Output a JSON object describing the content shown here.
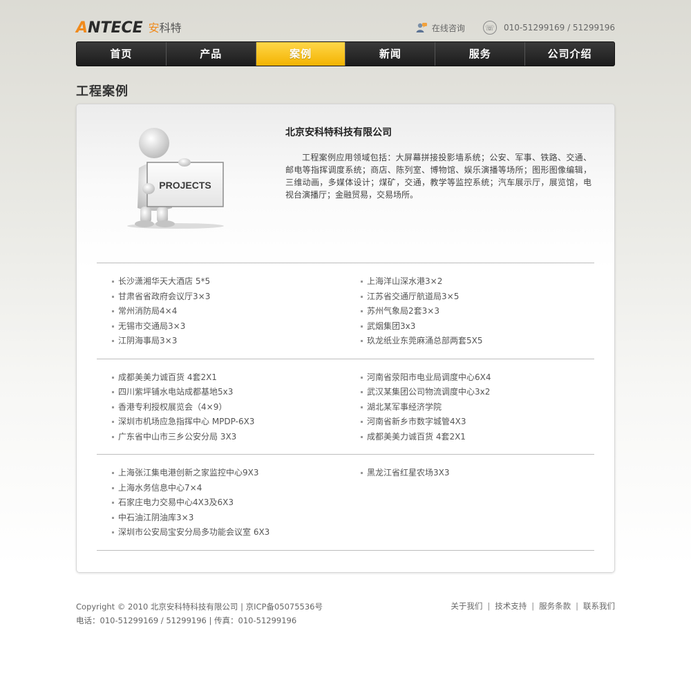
{
  "header": {
    "logo_latin_first": "A",
    "logo_latin_rest": "NTECE",
    "logo_cn_first": "安",
    "logo_cn_rest": "科特",
    "consult_label": "在线咨询",
    "phone_label": "010-51299169 / 51299196"
  },
  "nav": {
    "items": [
      {
        "label": "首页"
      },
      {
        "label": "产品"
      },
      {
        "label": "案例"
      },
      {
        "label": "新闻"
      },
      {
        "label": "服务"
      },
      {
        "label": "公司介绍"
      }
    ],
    "active_index": 2
  },
  "page_title": "工程案例",
  "main": {
    "image_label": "PROJECTS",
    "company_name": "北京安科特科技有限公司",
    "intro": "工程案例应用领域包括：大屏幕拼接投影墙系统；公安、军事、铁路、交通、邮电等指挥调度系统；商店、陈列室、博物馆、娱乐演播等场所；图形图像编辑，三维动画，多媒体设计；煤矿，交通，教学等监控系统；汽车展示厅，展览馆，电视台演播厅；金融贸易，交易场所。"
  },
  "projects": {
    "groups": [
      {
        "left": [
          "长沙潇湘华天大酒店 5*5",
          "甘肃省省政府会议厅3×3",
          "常州消防局4×4",
          "无锡市交通局3×3",
          "江阴海事局3×3"
        ],
        "right": [
          "上海洋山深水港3×2",
          "江苏省交通厅航道局3×5",
          "苏州气象局2套3×3",
          "武烟集团3x3",
          "玖龙纸业东莞麻涌总部两套5X5"
        ]
      },
      {
        "left": [
          "成都美美力诚百货 4套2X1",
          "四川紫坪铺水电站成都基地5x3",
          "香港专利授权展览会（4×9）",
          "深圳市机场应急指挥中心 MPDP-6X3",
          "广东省中山市三乡公安分局 3X3"
        ],
        "right": [
          "河南省荥阳市电业局调度中心6X4",
          "武汉某集团公司物流调度中心3x2",
          "湖北某军事经济学院",
          "河南省新乡市数字城管4X3",
          "成都美美力诚百货 4套2X1"
        ]
      },
      {
        "left": [
          "上海张江集电港创新之家监控中心9X3",
          "上海水务信息中心7×4",
          "石家庄电力交易中心4X3及6X3",
          "中石油江阴油库3×3",
          "深圳市公安局宝安分局多功能会议室 6X3"
        ],
        "right": [
          "黑龙江省红星农场3X3"
        ]
      }
    ]
  },
  "footer": {
    "copyright": "Copyright © 2010 北京安科特科技有限公司 | 京ICP备05075536号",
    "contact": "电话：010-51299169 / 51299196 | 传真：010-51299196",
    "links": [
      "关于我们",
      "技术支持",
      "服务条款",
      "联系我们"
    ]
  },
  "colors": {
    "accent": "#f08a1c",
    "nav_active": "#f3b300",
    "nav_bg": "#1c1c1c"
  }
}
